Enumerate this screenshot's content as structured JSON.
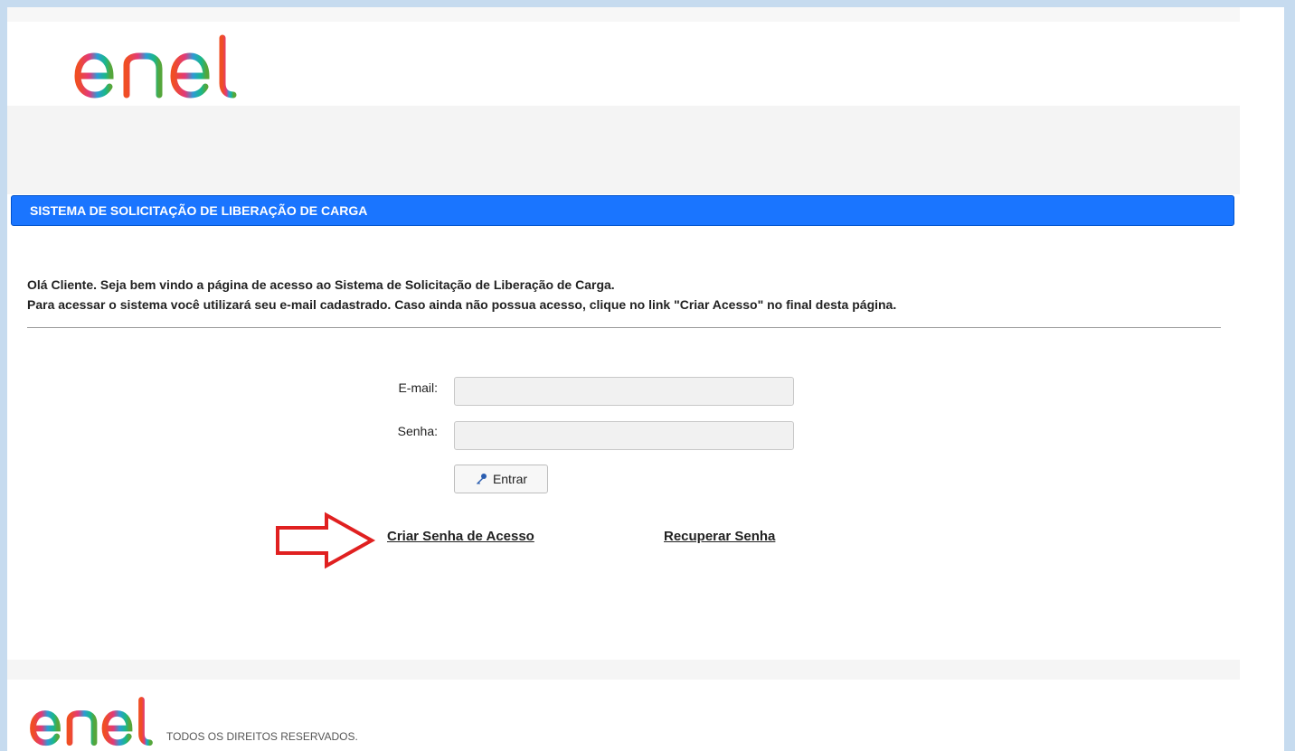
{
  "header": {
    "logo_text": "enel"
  },
  "title_bar": {
    "title": "SISTEMA DE SOLICITAÇÃO DE LIBERAÇÃO DE CARGA"
  },
  "intro": {
    "line1": "Olá Cliente. Seja bem vindo a página de acesso ao Sistema de Solicitação de Liberação de Carga.",
    "line2": "Para acessar o sistema você utilizará seu e-mail cadastrado. Caso ainda não possua acesso, clique no link \"Criar Acesso\" no final desta página."
  },
  "form": {
    "email_label": "E-mail:",
    "email_value": "",
    "password_label": "Senha:",
    "password_value": "",
    "submit_label": "Entrar",
    "submit_icon": "key-icon"
  },
  "links": {
    "create_password": "Criar Senha de Acesso",
    "recover_password": "Recuperar Senha"
  },
  "annotation": {
    "arrow_color": "#e02020"
  },
  "footer": {
    "logo_text": "enel",
    "rights": "TODOS OS DIREITOS RESERVADOS."
  },
  "colors": {
    "title_bar": "#1a75ff",
    "logo_gradient": [
      "#f04e23",
      "#e2397a",
      "#2d9bd6",
      "#19b88a",
      "#55a63b"
    ]
  }
}
